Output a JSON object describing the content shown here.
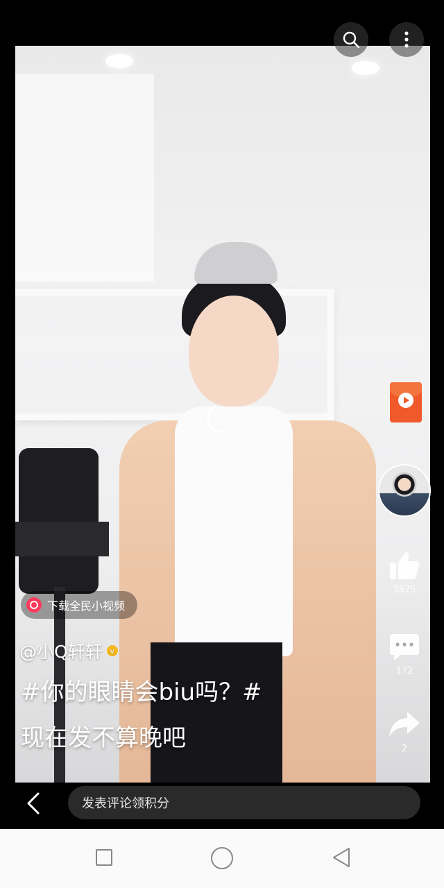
{
  "top_actions": [
    {
      "icon": "search-icon"
    },
    {
      "icon": "more-vertical-icon"
    }
  ],
  "side_actions": {
    "red_packet_icon": "red-packet-icon",
    "author_avatar_icon": "avatar",
    "like": {
      "icon": "thumbs-up-icon",
      "count": "3875"
    },
    "comment": {
      "icon": "comment-bubble-icon",
      "count": "172"
    },
    "share": {
      "icon": "share-arrow-icon",
      "count": "2"
    }
  },
  "download_banner": {
    "label": "下载全民小视频"
  },
  "post": {
    "author": "@小Q轩轩",
    "title_line1": "#你的眼睛会biu吗？#",
    "title_line2": "现在发不算晚吧"
  },
  "bottom_bar": {
    "back_icon": "back-chevron-icon",
    "comment_placeholder": "发表评论领积分"
  },
  "colors": {
    "red_packet": "#f05a2a",
    "verified_badge": "#f4b81c",
    "download_logo": "#ff3b5c"
  }
}
